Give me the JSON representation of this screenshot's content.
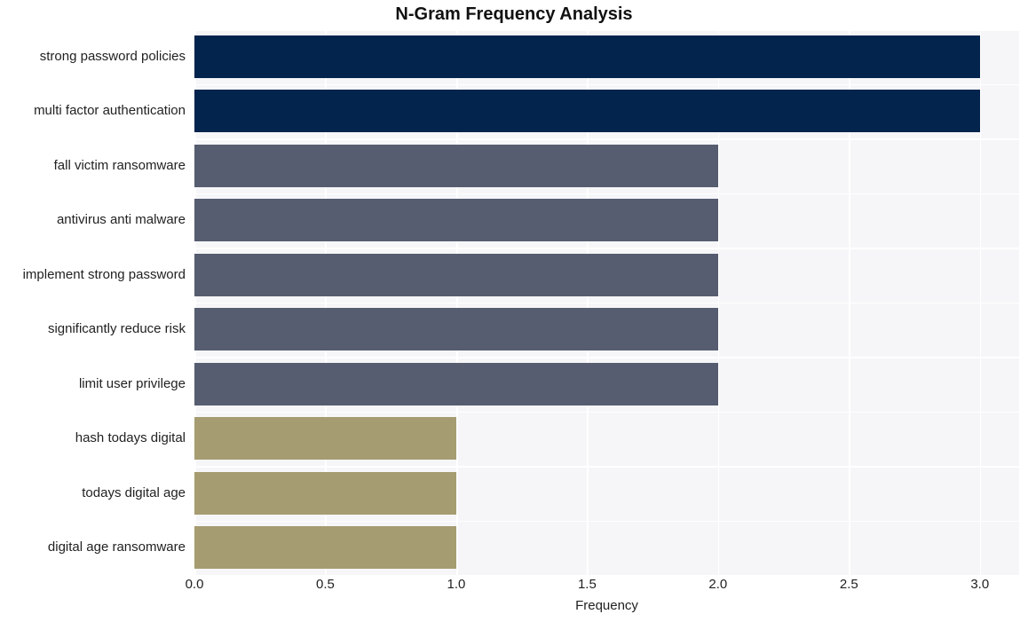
{
  "chart_data": {
    "type": "bar",
    "orientation": "horizontal",
    "title": "N-Gram Frequency Analysis",
    "xlabel": "Frequency",
    "ylabel": "",
    "categories": [
      "strong password policies",
      "multi factor authentication",
      "fall victim ransomware",
      "antivirus anti malware",
      "implement strong password",
      "significantly reduce risk",
      "limit user privilege",
      "hash todays digital",
      "todays digital age",
      "digital age ransomware"
    ],
    "values": [
      3,
      3,
      2,
      2,
      2,
      2,
      2,
      1,
      1,
      1
    ],
    "bar_colors": [
      "#03244d",
      "#03244d",
      "#565d70",
      "#565d70",
      "#565d70",
      "#565d70",
      "#565d70",
      "#a69c71",
      "#a69c71",
      "#a69c71"
    ],
    "xlim": [
      0.0,
      3.15
    ],
    "xticks": [
      0.0,
      0.5,
      1.0,
      1.5,
      2.0,
      2.5,
      3.0
    ],
    "xtick_labels": [
      "0.0",
      "0.5",
      "1.0",
      "1.5",
      "2.0",
      "2.5",
      "3.0"
    ],
    "grid": true,
    "grid_color": "#ffffff",
    "plot_background": "#f6f6f8",
    "figure_background": "#ffffff",
    "legend": null
  }
}
